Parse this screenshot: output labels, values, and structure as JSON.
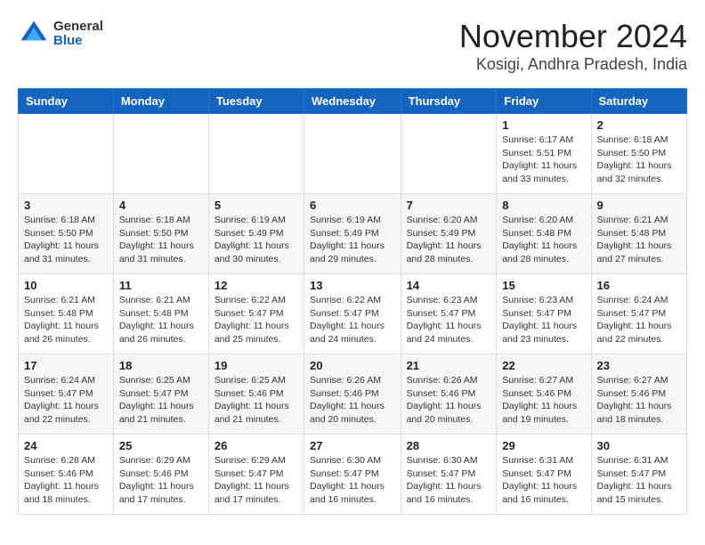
{
  "app": {
    "name": "GeneralBlue",
    "logo_general": "General",
    "logo_blue": "Blue"
  },
  "calendar": {
    "month": "November 2024",
    "location": "Kosigi, Andhra Pradesh, India",
    "days_of_week": [
      "Sunday",
      "Monday",
      "Tuesday",
      "Wednesday",
      "Thursday",
      "Friday",
      "Saturday"
    ],
    "weeks": [
      [
        {
          "day": "",
          "info": ""
        },
        {
          "day": "",
          "info": ""
        },
        {
          "day": "",
          "info": ""
        },
        {
          "day": "",
          "info": ""
        },
        {
          "day": "",
          "info": ""
        },
        {
          "day": "1",
          "info": "Sunrise: 6:17 AM\nSunset: 5:51 PM\nDaylight: 11 hours and 33 minutes."
        },
        {
          "day": "2",
          "info": "Sunrise: 6:18 AM\nSunset: 5:50 PM\nDaylight: 11 hours and 32 minutes."
        }
      ],
      [
        {
          "day": "3",
          "info": "Sunrise: 6:18 AM\nSunset: 5:50 PM\nDaylight: 11 hours and 31 minutes."
        },
        {
          "day": "4",
          "info": "Sunrise: 6:18 AM\nSunset: 5:50 PM\nDaylight: 11 hours and 31 minutes."
        },
        {
          "day": "5",
          "info": "Sunrise: 6:19 AM\nSunset: 5:49 PM\nDaylight: 11 hours and 30 minutes."
        },
        {
          "day": "6",
          "info": "Sunrise: 6:19 AM\nSunset: 5:49 PM\nDaylight: 11 hours and 29 minutes."
        },
        {
          "day": "7",
          "info": "Sunrise: 6:20 AM\nSunset: 5:49 PM\nDaylight: 11 hours and 28 minutes."
        },
        {
          "day": "8",
          "info": "Sunrise: 6:20 AM\nSunset: 5:48 PM\nDaylight: 11 hours and 28 minutes."
        },
        {
          "day": "9",
          "info": "Sunrise: 6:21 AM\nSunset: 5:48 PM\nDaylight: 11 hours and 27 minutes."
        }
      ],
      [
        {
          "day": "10",
          "info": "Sunrise: 6:21 AM\nSunset: 5:48 PM\nDaylight: 11 hours and 26 minutes."
        },
        {
          "day": "11",
          "info": "Sunrise: 6:21 AM\nSunset: 5:48 PM\nDaylight: 11 hours and 26 minutes."
        },
        {
          "day": "12",
          "info": "Sunrise: 6:22 AM\nSunset: 5:47 PM\nDaylight: 11 hours and 25 minutes."
        },
        {
          "day": "13",
          "info": "Sunrise: 6:22 AM\nSunset: 5:47 PM\nDaylight: 11 hours and 24 minutes."
        },
        {
          "day": "14",
          "info": "Sunrise: 6:23 AM\nSunset: 5:47 PM\nDaylight: 11 hours and 24 minutes."
        },
        {
          "day": "15",
          "info": "Sunrise: 6:23 AM\nSunset: 5:47 PM\nDaylight: 11 hours and 23 minutes."
        },
        {
          "day": "16",
          "info": "Sunrise: 6:24 AM\nSunset: 5:47 PM\nDaylight: 11 hours and 22 minutes."
        }
      ],
      [
        {
          "day": "17",
          "info": "Sunrise: 6:24 AM\nSunset: 5:47 PM\nDaylight: 11 hours and 22 minutes."
        },
        {
          "day": "18",
          "info": "Sunrise: 6:25 AM\nSunset: 5:47 PM\nDaylight: 11 hours and 21 minutes."
        },
        {
          "day": "19",
          "info": "Sunrise: 6:25 AM\nSunset: 5:46 PM\nDaylight: 11 hours and 21 minutes."
        },
        {
          "day": "20",
          "info": "Sunrise: 6:26 AM\nSunset: 5:46 PM\nDaylight: 11 hours and 20 minutes."
        },
        {
          "day": "21",
          "info": "Sunrise: 6:26 AM\nSunset: 5:46 PM\nDaylight: 11 hours and 20 minutes."
        },
        {
          "day": "22",
          "info": "Sunrise: 6:27 AM\nSunset: 5:46 PM\nDaylight: 11 hours and 19 minutes."
        },
        {
          "day": "23",
          "info": "Sunrise: 6:27 AM\nSunset: 5:46 PM\nDaylight: 11 hours and 18 minutes."
        }
      ],
      [
        {
          "day": "24",
          "info": "Sunrise: 6:28 AM\nSunset: 5:46 PM\nDaylight: 11 hours and 18 minutes."
        },
        {
          "day": "25",
          "info": "Sunrise: 6:29 AM\nSunset: 5:46 PM\nDaylight: 11 hours and 17 minutes."
        },
        {
          "day": "26",
          "info": "Sunrise: 6:29 AM\nSunset: 5:47 PM\nDaylight: 11 hours and 17 minutes."
        },
        {
          "day": "27",
          "info": "Sunrise: 6:30 AM\nSunset: 5:47 PM\nDaylight: 11 hours and 16 minutes."
        },
        {
          "day": "28",
          "info": "Sunrise: 6:30 AM\nSunset: 5:47 PM\nDaylight: 11 hours and 16 minutes."
        },
        {
          "day": "29",
          "info": "Sunrise: 6:31 AM\nSunset: 5:47 PM\nDaylight: 11 hours and 16 minutes."
        },
        {
          "day": "30",
          "info": "Sunrise: 6:31 AM\nSunset: 5:47 PM\nDaylight: 11 hours and 15 minutes."
        }
      ]
    ]
  }
}
